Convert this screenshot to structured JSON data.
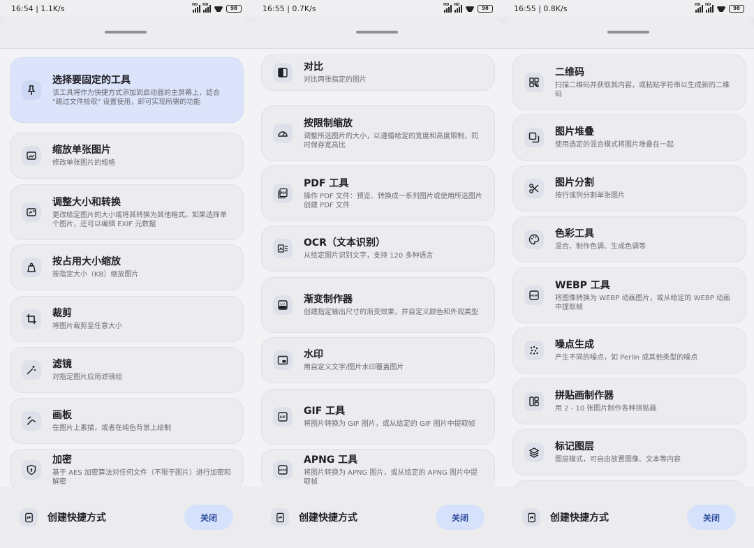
{
  "screens": [
    {
      "status": {
        "time": "16:54 | 1.1K/s",
        "battery": "98"
      },
      "footer": {
        "label": "创建快捷方式",
        "close": "关闭"
      },
      "cards": [
        {
          "title": "选择要固定的工具",
          "desc": "该工具将作为快捷方式添加到启动器的主屏幕上，结合 \"跳过文件拾取\" 设置使用，即可实现所需的功能",
          "icon": "pin-icon",
          "selected": true
        },
        {
          "title": "缩放单张图片",
          "desc": "修改单张图片的规格",
          "icon": "image-edit-icon"
        },
        {
          "title": "调整大小和转换",
          "desc": "更改给定图片的大小或将其转换为其他格式。如果选择单个图片，还可以编辑 EXIF 元数据",
          "icon": "resize-convert-icon"
        },
        {
          "title": "按占用大小缩放",
          "desc": "按指定大小（KB）缩放图片",
          "icon": "weight-icon"
        },
        {
          "title": "裁剪",
          "desc": "将图片裁剪至任意大小",
          "icon": "crop-icon"
        },
        {
          "title": "滤镜",
          "desc": "对指定图片应用滤镜组",
          "icon": "magic-wand-icon"
        },
        {
          "title": "画板",
          "desc": "在图片上素描，或者在纯色背景上绘制",
          "icon": "draw-icon"
        },
        {
          "title": "加密",
          "desc": "基于 AES 加密算法对任何文件（不限于图片）进行加密和解密",
          "icon": "shield-lock-icon"
        }
      ]
    },
    {
      "status": {
        "time": "16:55 | 0.7K/s",
        "battery": "98"
      },
      "footer": {
        "label": "创建快捷方式",
        "close": "关闭"
      },
      "cards": [
        {
          "title": "对比",
          "desc": "对比两张指定的图片",
          "icon": "compare-icon"
        },
        {
          "title": "按限制缩放",
          "desc": "调整所选图片的大小，以遵循给定的宽度和高度限制，同时保存宽高比",
          "icon": "speedometer-icon"
        },
        {
          "title": "PDF 工具",
          "desc": "操作 PDF 文件：预览、转换成一系列图片或使用所选图片创建 PDF 文件",
          "icon": "pdf-icon"
        },
        {
          "title": "OCR（文本识别）",
          "desc": "从给定图片识别文字，支持 120 多种语言",
          "icon": "ocr-icon"
        },
        {
          "title": "渐变制作器",
          "desc": "创建指定输出尺寸的渐变效果，并自定义颜色和外观类型",
          "icon": "gradient-icon"
        },
        {
          "title": "水印",
          "desc": "用自定义文字/图片水印覆盖图片",
          "icon": "watermark-icon"
        },
        {
          "title": "GIF 工具",
          "desc": "将图片转换为 GIF 图片，或从给定的 GIF 图片中提取帧",
          "icon": "gif-icon"
        },
        {
          "title": "APNG 工具",
          "desc": "将图片转换为 APNG 图片，或从给定的 APNG 图片中提取帧",
          "icon": "apng-icon"
        }
      ]
    },
    {
      "status": {
        "time": "16:55 | 0.8K/s",
        "battery": "98"
      },
      "footer": {
        "label": "创建快捷方式",
        "close": "关闭"
      },
      "cards": [
        {
          "title": "二维码",
          "desc": "扫描二维码并获取其内容，或粘贴字符串以生成新的二维码",
          "icon": "qr-code-icon"
        },
        {
          "title": "图片堆叠",
          "desc": "使用选定的混合模式将图片堆叠在一起",
          "icon": "stack-icon"
        },
        {
          "title": "图片分割",
          "desc": "按行或列分割单张图片",
          "icon": "scissors-icon"
        },
        {
          "title": "色彩工具",
          "desc": "混合、制作色调、生成色调等",
          "icon": "palette-icon"
        },
        {
          "title": "WEBP 工具",
          "desc": "将图像转换为 WEBP 动画图片，或从给定的 WEBP 动画中提取帧",
          "icon": "webp-icon"
        },
        {
          "title": "噪点生成",
          "desc": "产生不同的噪点，如 Perlin 或其他类型的噪点",
          "icon": "noise-icon"
        },
        {
          "title": "拼贴画制作器",
          "desc": "用 2 - 10 张图片制作各种拼贴画",
          "icon": "collage-icon"
        },
        {
          "title": "标记图层",
          "desc": "图层模式，可自由放置图像、文本等内容",
          "icon": "layers-icon"
        }
      ]
    }
  ]
}
